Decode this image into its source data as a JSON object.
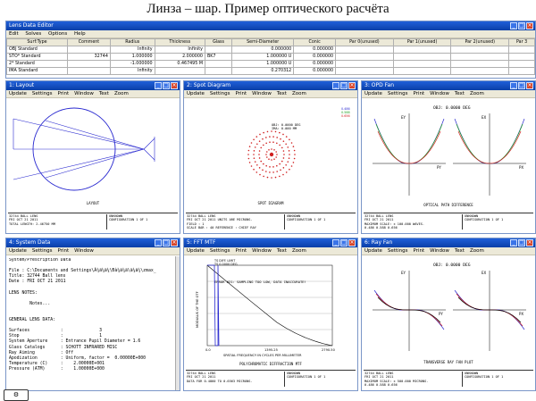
{
  "page_title": "Линза – шар. Пример оптического расчёта",
  "lde": {
    "title": "Lens Data Editor",
    "menu": [
      "Edit",
      "Solves",
      "Options",
      "Help"
    ],
    "columns": [
      "Surf:Type",
      "Comment",
      "Radius",
      "Thickness",
      "Glass",
      "Semi-Diameter",
      "Conic",
      "Par 0(unused)",
      "Par 1(unused)",
      "Par 2(unused)",
      "Par 3"
    ],
    "rows": [
      {
        "surf": "OBJ",
        "type": "Standard",
        "comment": "",
        "radius": "Infinity",
        "thick": "Infinity",
        "m": "",
        "glass": "",
        "semi": "0.000000",
        "sm": "",
        "conic": "0.000000"
      },
      {
        "surf": "STO*",
        "type": "Standard",
        "comment": "32744",
        "radius": "1.000000",
        "thick": "2.000000",
        "m": "",
        "glass": "BK7",
        "semi": "1.000000",
        "sm": "U",
        "conic": "0.000000"
      },
      {
        "surf": "2*",
        "type": "Standard",
        "comment": "",
        "radius": "-1.000000",
        "thick": "0.467495",
        "m": "M",
        "glass": "",
        "semi": "1.000000",
        "sm": "U",
        "conic": "0.000000"
      },
      {
        "surf": "IMA",
        "type": "Standard",
        "comment": "",
        "radius": "Infinity",
        "thick": "",
        "m": "",
        "glass": "",
        "semi": "0.270312",
        "sm": "",
        "conic": "0.000000"
      }
    ]
  },
  "toolbar": [
    "Update",
    "Settings",
    "Print",
    "Window",
    "Text",
    "Zoom"
  ],
  "layout": {
    "title": "1: Layout",
    "caption": "LAYOUT",
    "info_left": [
      "32744 BALL LENS",
      "FRI OCT 21 2011",
      "TOTAL LENGTH:    2.46750 MM"
    ],
    "info_right": [
      "UNKNOWN",
      "CONFIGURATION 1 OF 1"
    ]
  },
  "spot": {
    "title": "2: Spot Diagram",
    "caption": "SPOT DIAGRAM",
    "top_labels": [
      "OBJ: 0.0000 DEG",
      "IMA: 0.000 MM"
    ],
    "info_left": [
      "32744 BALL LENS",
      "FRI OCT 21 2011 UNITS ARE MICRONS.",
      "FIELD  :  1",
      "RMS RADIUS : 5.071",
      "GEO RADIUS : 16.127",
      "SCALE BAR : 40  REFERENCE : CHIEF RAY"
    ],
    "info_right": [
      "UNKNOWN",
      "CONFIGURATION 1 OF 1"
    ],
    "legend": [
      "0.486",
      "0.588",
      "0.656"
    ],
    "legend_colors": [
      "#2a2ad0",
      "#22a022",
      "#d02020"
    ],
    "bottom_value": "0.270312"
  },
  "opd": {
    "title": "3: OPD Fan",
    "caption": "OPTICAL PATH DIFFERENCE",
    "field_label": "OBJ: 0.0000 DEG",
    "axis_labels": [
      "PY",
      "PX",
      "EY",
      "EX",
      "W"
    ],
    "info_left": [
      "32744 BALL LENS",
      "FRI OCT 21 2011",
      "MAXIMUM SCALE: ± 100.000 WAVES.",
      "0.486  0.588  0.656"
    ],
    "info_right": [
      "UNKNOWN",
      "CONFIGURATION 1 OF 1"
    ]
  },
  "sysdata": {
    "title": "4: System Data",
    "menu": [
      "Update",
      "Settings",
      "Print",
      "Window"
    ],
    "lines": [
      "System/Prescription Data",
      "",
      "File : C:\\Documents and Settings\\Á¼ä¼ä¼\\Ðà¼ä¼ä\\ä¼ä¼\\zmax_",
      "Title: 32744 Ball lens",
      "Date : FRI OCT 21 2011",
      "",
      "LENS NOTES:",
      "",
      "        Notes...",
      "",
      "",
      "GENERAL LENS DATA:",
      "",
      "Surfaces            :              3",
      "Stop                :              1",
      "System Aperture     : Entrance Pupil Diameter = 1.6",
      "Glass Catalogs      : SCHOTT INFRARED MISC",
      "Ray Aiming          : Off",
      "Apodization         : Uniform, factor =  0.00000E+000",
      "Temperature (C)     :    2.00000E+001",
      "Pressure (ATM)      :    1.00000E+000"
    ]
  },
  "mtf": {
    "title": "5: FFT MTF",
    "caption": "POLYCHROMATIC DIFFRACTION MTF",
    "warning": "ERROR #21: SAMPLING TOO LOW, DATA INACCURATE!",
    "ylabel": "MODULUS OF THE OTF",
    "xlabel": "SPATIAL FREQUENCY IN CYCLES PER MILLIMETER",
    "xticks": [
      "0.0",
      "1395.25",
      "2790.50"
    ],
    "legend": [
      "TS DIFF. LIMIT",
      "TS 0.0000 DEG"
    ],
    "info_left": [
      "32744 BALL LENS",
      "FRI OCT 21 2011",
      "DATA FOR 0.4860 TO 0.6563 MICRONS."
    ],
    "info_right": [
      "UNKNOWN",
      "CONFIGURATION 1 OF 1"
    ]
  },
  "rayfan": {
    "title": "6: Ray Fan",
    "caption": "TRANSVERSE RAY FAN PLOT",
    "field_label": "OBJ: 0.0000 DEG",
    "axis_labels": [
      "EY",
      "EX",
      "PY",
      "PX"
    ],
    "info_left": [
      "32744 BALL LENS",
      "FRI OCT 21 2011",
      "MAXIMUM SCALE: ± 500.000 MICRONS.",
      "0.486  0.588  0.656"
    ],
    "info_right": [
      "UNKNOWN",
      "CONFIGURATION 1 OF 1"
    ]
  },
  "colors": {
    "blue": "#2a2ad0",
    "green": "#22a022",
    "red": "#d02020",
    "titlebar": "#0a3fa8"
  }
}
